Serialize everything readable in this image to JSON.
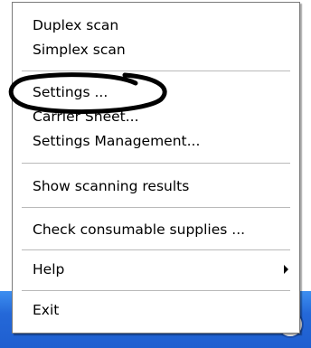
{
  "menu": {
    "items": [
      {
        "label": "Duplex scan"
      },
      {
        "label": "Simplex scan"
      },
      {
        "label": "Settings ..."
      },
      {
        "label": "Carrier Sheet..."
      },
      {
        "label": "Settings Management..."
      },
      {
        "label": "Show scanning results"
      },
      {
        "label": "Check consumable supplies ..."
      },
      {
        "label": "Help"
      },
      {
        "label": "Exit"
      }
    ]
  },
  "taskbar": {
    "language": "EN",
    "tray_icon": "scanner-tray-icon"
  },
  "annotation": {
    "shape": "ellipse",
    "target": "Settings ...",
    "color": "#000000"
  },
  "colors": {
    "taskbar": "#2468d8",
    "menu_background": "#ffffff"
  }
}
